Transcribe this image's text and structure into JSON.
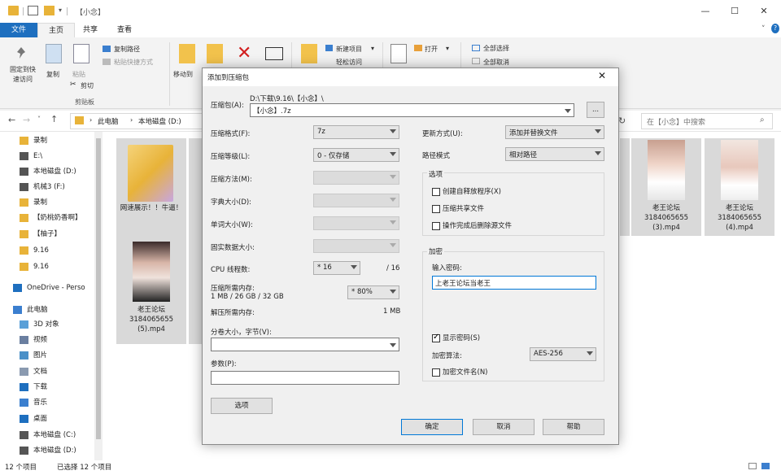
{
  "explorer": {
    "title": "【小念】",
    "tabs": {
      "file": "文件",
      "home": "主页",
      "share": "共享",
      "view": "查看"
    },
    "ribbon": {
      "pin_quick": "固定到快\n速访问",
      "copy": "复制",
      "paste": "粘贴",
      "copy_path": "复制路径",
      "paste_shortcut": "粘贴快捷方式",
      "cut": "剪切",
      "clipboard_group": "剪贴板",
      "move_to": "移动到",
      "new_item": "新建项目",
      "easy_access": "轻松访问",
      "open": "打开",
      "select_all": "全部选择",
      "select_none": "全部取消"
    },
    "breadcrumb": [
      "此电脑",
      "本地磁盘 (D:)"
    ],
    "search_placeholder": "在【小念】中搜索",
    "nav_items": [
      {
        "label": "录制",
        "icon": "folder-icon"
      },
      {
        "label": "E:\\",
        "icon": "drive-icon"
      },
      {
        "label": "本地磁盘 (D:)",
        "icon": "drive-icon"
      },
      {
        "label": "机械3 (F:)",
        "icon": "drive-icon"
      },
      {
        "label": "录制",
        "icon": "folder-icon"
      },
      {
        "label": "【奶桃奶香啊】",
        "icon": "folder-icon"
      },
      {
        "label": "【柚子】",
        "icon": "folder-icon"
      },
      {
        "label": "9.16",
        "icon": "folder-icon"
      },
      {
        "label": "9.16",
        "icon": "folder-icon"
      },
      {
        "label": "OneDrive - Perso",
        "icon": "cloud-icon"
      },
      {
        "label": "此电脑",
        "icon": "pc-icon"
      },
      {
        "label": "3D 对象",
        "icon": "cube-icon"
      },
      {
        "label": "视频",
        "icon": "video-icon"
      },
      {
        "label": "图片",
        "icon": "picture-icon"
      },
      {
        "label": "文档",
        "icon": "document-icon"
      },
      {
        "label": "下载",
        "icon": "download-icon"
      },
      {
        "label": "音乐",
        "icon": "music-icon"
      },
      {
        "label": "桌面",
        "icon": "desktop-icon"
      },
      {
        "label": "本地磁盘 (C:)",
        "icon": "drive-icon"
      },
      {
        "label": "本地磁盘 (D:)",
        "icon": "drive-icon"
      }
    ],
    "files": [
      {
        "name": "网速展示！！牛逼！"
      },
      {
        "name": "老王论坛\n3184065655\n(5).mp4"
      },
      {
        "name": "老王论坛\n3184065655\n(3).mp4"
      },
      {
        "name": "老王论坛\n3184065655\n(4).mp4"
      }
    ],
    "status": {
      "count": "12 个项目",
      "selected": "已选择 12 个项目"
    }
  },
  "dialog": {
    "title": "添加到压缩包",
    "archive_label": "压缩包(A):",
    "archive_path": "D:\\下载\\9.16\\【小念】\\",
    "archive_name": "【小念】.7z",
    "browse": "...",
    "format_label": "压缩格式(F):",
    "format_value": "7z",
    "level_label": "压缩等级(L):",
    "level_value": "0 - 仅存储",
    "method_label": "压缩方法(M):",
    "dict_label": "字典大小(D):",
    "word_label": "单词大小(W):",
    "solid_label": "固实数据大小:",
    "cpu_label": "CPU 线程数:",
    "cpu_value": "* 16",
    "cpu_total": "/ 16",
    "mem_label": "压缩所需内存:",
    "mem_detail": "1 MB / 26 GB / 32 GB",
    "mem_value": "* 80%",
    "mem_value_mb": "1 MB",
    "decomp_label": "解压所需内存:",
    "split_label": "分卷大小，字节(V):",
    "params_label": "参数(P):",
    "options_button": "选项",
    "update_label": "更新方式(U):",
    "update_value": "添加并替换文件",
    "path_label": "路径模式",
    "path_value": "相对路径",
    "options_group": "选项",
    "opt_sfx": "创建自释放程序(X)",
    "opt_shared": "压缩共享文件",
    "opt_delete": "操作完成后删除源文件",
    "encrypt_group": "加密",
    "password_label": "输入密码:",
    "password_value": "上老王论坛当老王",
    "show_password": "显示密码(S)",
    "enc_method_label": "加密算法:",
    "enc_method_value": "AES-256",
    "enc_names": "加密文件名(N)",
    "ok": "确定",
    "cancel": "取消",
    "help": "帮助"
  }
}
